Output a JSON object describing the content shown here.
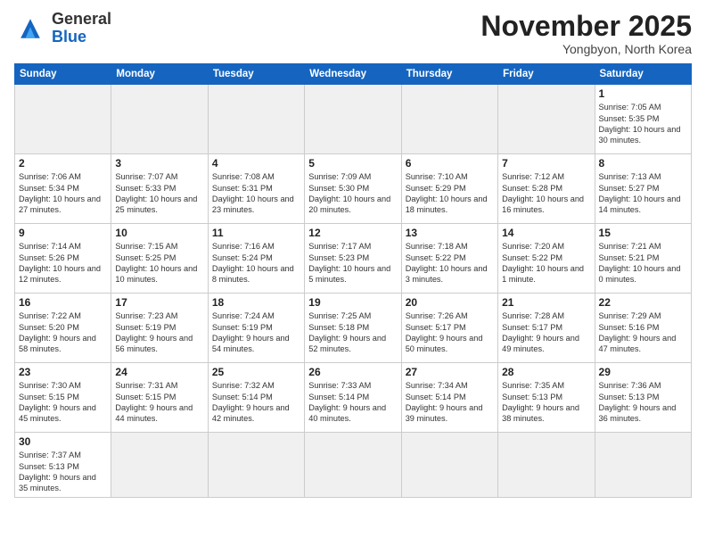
{
  "logo": {
    "general": "General",
    "blue": "Blue"
  },
  "header": {
    "month": "November 2025",
    "location": "Yongbyon, North Korea"
  },
  "weekdays": [
    "Sunday",
    "Monday",
    "Tuesday",
    "Wednesday",
    "Thursday",
    "Friday",
    "Saturday"
  ],
  "days": [
    {
      "num": "",
      "info": ""
    },
    {
      "num": "",
      "info": ""
    },
    {
      "num": "",
      "info": ""
    },
    {
      "num": "",
      "info": ""
    },
    {
      "num": "",
      "info": ""
    },
    {
      "num": "",
      "info": ""
    },
    {
      "num": "1",
      "info": "Sunrise: 7:05 AM\nSunset: 5:35 PM\nDaylight: 10 hours\nand 30 minutes."
    }
  ],
  "week2": [
    {
      "num": "2",
      "info": "Sunrise: 7:06 AM\nSunset: 5:34 PM\nDaylight: 10 hours\nand 27 minutes."
    },
    {
      "num": "3",
      "info": "Sunrise: 7:07 AM\nSunset: 5:33 PM\nDaylight: 10 hours\nand 25 minutes."
    },
    {
      "num": "4",
      "info": "Sunrise: 7:08 AM\nSunset: 5:31 PM\nDaylight: 10 hours\nand 23 minutes."
    },
    {
      "num": "5",
      "info": "Sunrise: 7:09 AM\nSunset: 5:30 PM\nDaylight: 10 hours\nand 20 minutes."
    },
    {
      "num": "6",
      "info": "Sunrise: 7:10 AM\nSunset: 5:29 PM\nDaylight: 10 hours\nand 18 minutes."
    },
    {
      "num": "7",
      "info": "Sunrise: 7:12 AM\nSunset: 5:28 PM\nDaylight: 10 hours\nand 16 minutes."
    },
    {
      "num": "8",
      "info": "Sunrise: 7:13 AM\nSunset: 5:27 PM\nDaylight: 10 hours\nand 14 minutes."
    }
  ],
  "week3": [
    {
      "num": "9",
      "info": "Sunrise: 7:14 AM\nSunset: 5:26 PM\nDaylight: 10 hours\nand 12 minutes."
    },
    {
      "num": "10",
      "info": "Sunrise: 7:15 AM\nSunset: 5:25 PM\nDaylight: 10 hours\nand 10 minutes."
    },
    {
      "num": "11",
      "info": "Sunrise: 7:16 AM\nSunset: 5:24 PM\nDaylight: 10 hours\nand 8 minutes."
    },
    {
      "num": "12",
      "info": "Sunrise: 7:17 AM\nSunset: 5:23 PM\nDaylight: 10 hours\nand 5 minutes."
    },
    {
      "num": "13",
      "info": "Sunrise: 7:18 AM\nSunset: 5:22 PM\nDaylight: 10 hours\nand 3 minutes."
    },
    {
      "num": "14",
      "info": "Sunrise: 7:20 AM\nSunset: 5:22 PM\nDaylight: 10 hours\nand 1 minute."
    },
    {
      "num": "15",
      "info": "Sunrise: 7:21 AM\nSunset: 5:21 PM\nDaylight: 10 hours\nand 0 minutes."
    }
  ],
  "week4": [
    {
      "num": "16",
      "info": "Sunrise: 7:22 AM\nSunset: 5:20 PM\nDaylight: 9 hours\nand 58 minutes."
    },
    {
      "num": "17",
      "info": "Sunrise: 7:23 AM\nSunset: 5:19 PM\nDaylight: 9 hours\nand 56 minutes."
    },
    {
      "num": "18",
      "info": "Sunrise: 7:24 AM\nSunset: 5:19 PM\nDaylight: 9 hours\nand 54 minutes."
    },
    {
      "num": "19",
      "info": "Sunrise: 7:25 AM\nSunset: 5:18 PM\nDaylight: 9 hours\nand 52 minutes."
    },
    {
      "num": "20",
      "info": "Sunrise: 7:26 AM\nSunset: 5:17 PM\nDaylight: 9 hours\nand 50 minutes."
    },
    {
      "num": "21",
      "info": "Sunrise: 7:28 AM\nSunset: 5:17 PM\nDaylight: 9 hours\nand 49 minutes."
    },
    {
      "num": "22",
      "info": "Sunrise: 7:29 AM\nSunset: 5:16 PM\nDaylight: 9 hours\nand 47 minutes."
    }
  ],
  "week5": [
    {
      "num": "23",
      "info": "Sunrise: 7:30 AM\nSunset: 5:15 PM\nDaylight: 9 hours\nand 45 minutes."
    },
    {
      "num": "24",
      "info": "Sunrise: 7:31 AM\nSunset: 5:15 PM\nDaylight: 9 hours\nand 44 minutes."
    },
    {
      "num": "25",
      "info": "Sunrise: 7:32 AM\nSunset: 5:14 PM\nDaylight: 9 hours\nand 42 minutes."
    },
    {
      "num": "26",
      "info": "Sunrise: 7:33 AM\nSunset: 5:14 PM\nDaylight: 9 hours\nand 40 minutes."
    },
    {
      "num": "27",
      "info": "Sunrise: 7:34 AM\nSunset: 5:14 PM\nDaylight: 9 hours\nand 39 minutes."
    },
    {
      "num": "28",
      "info": "Sunrise: 7:35 AM\nSunset: 5:13 PM\nDaylight: 9 hours\nand 38 minutes."
    },
    {
      "num": "29",
      "info": "Sunrise: 7:36 AM\nSunset: 5:13 PM\nDaylight: 9 hours\nand 36 minutes."
    }
  ],
  "week6": [
    {
      "num": "30",
      "info": "Sunrise: 7:37 AM\nSunset: 5:13 PM\nDaylight: 9 hours\nand 35 minutes."
    },
    {
      "num": "",
      "info": ""
    },
    {
      "num": "",
      "info": ""
    },
    {
      "num": "",
      "info": ""
    },
    {
      "num": "",
      "info": ""
    },
    {
      "num": "",
      "info": ""
    },
    {
      "num": "",
      "info": ""
    }
  ]
}
